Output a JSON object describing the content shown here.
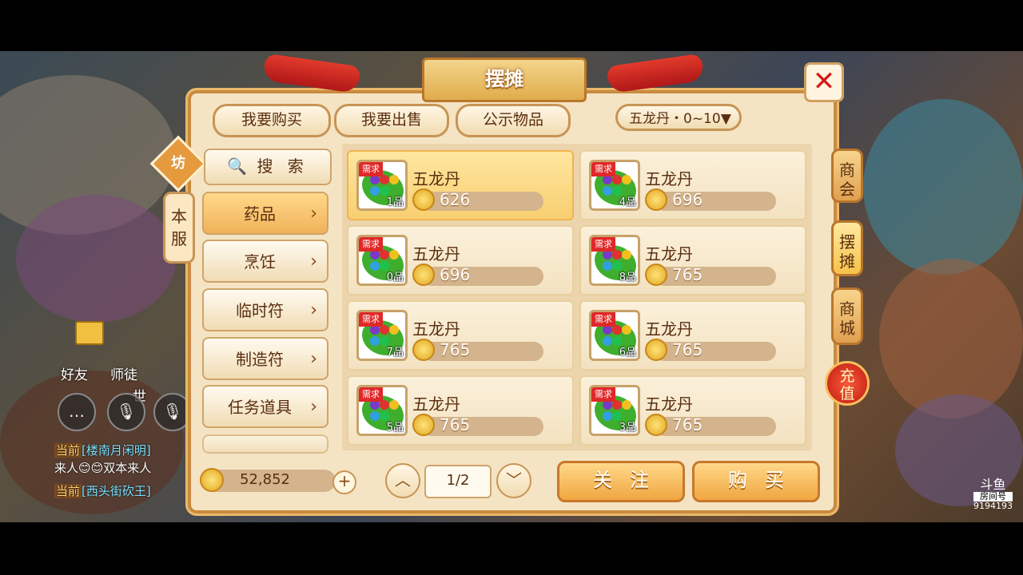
{
  "window": {
    "title": "摆摊"
  },
  "tabs": [
    {
      "label": "我要购买"
    },
    {
      "label": "我要出售"
    },
    {
      "label": "公示物品"
    }
  ],
  "filter": {
    "label": "五龙丹・0~10"
  },
  "server_tag": {
    "line1": "本",
    "line2": "服"
  },
  "stall_badge": "坊",
  "search": {
    "label": "搜 索"
  },
  "categories": [
    {
      "label": "药品",
      "active": true
    },
    {
      "label": "烹饪"
    },
    {
      "label": "临时符"
    },
    {
      "label": "制造符"
    },
    {
      "label": "任务道具"
    }
  ],
  "items": [
    {
      "name": "五龙丹",
      "grade": "1品",
      "price": "626",
      "tag": "需求"
    },
    {
      "name": "五龙丹",
      "grade": "4品",
      "price": "696",
      "tag": "需求"
    },
    {
      "name": "五龙丹",
      "grade": "0品",
      "price": "696",
      "tag": "需求"
    },
    {
      "name": "五龙丹",
      "grade": "8品",
      "price": "765",
      "tag": "需求"
    },
    {
      "name": "五龙丹",
      "grade": "7品",
      "price": "765",
      "tag": "需求"
    },
    {
      "name": "五龙丹",
      "grade": "6品",
      "price": "765",
      "tag": "需求"
    },
    {
      "name": "五龙丹",
      "grade": "5品",
      "price": "765",
      "tag": "需求"
    },
    {
      "name": "五龙丹",
      "grade": "3品",
      "price": "765",
      "tag": "需求"
    }
  ],
  "side_nav": [
    {
      "line1": "商",
      "line2": "会"
    },
    {
      "line1": "摆",
      "line2": "摊"
    },
    {
      "line1": "商",
      "line2": "城"
    }
  ],
  "recharge": {
    "line1": "充",
    "line2": "值"
  },
  "gold": {
    "value": "52,852"
  },
  "pagination": {
    "current": "1/2"
  },
  "actions": {
    "follow": "关注",
    "buy": "购买"
  },
  "social": {
    "friends": "好友",
    "mentor": "师徒",
    "world": "世"
  },
  "chat": [
    {
      "channel": "当前",
      "text": "[楼南月闲明]"
    },
    {
      "channel": "",
      "text": "来人😊😊双本来人"
    },
    {
      "channel": "当前",
      "text": "[西头街砍王]"
    }
  ],
  "watermark": {
    "brand": "斗鱼",
    "room_label": "房间号",
    "room": "9194193"
  },
  "colors": {
    "panel": "#f4e4c4",
    "accent": "#f0a640",
    "close": "#d41818",
    "selected": "#f8cf70"
  }
}
